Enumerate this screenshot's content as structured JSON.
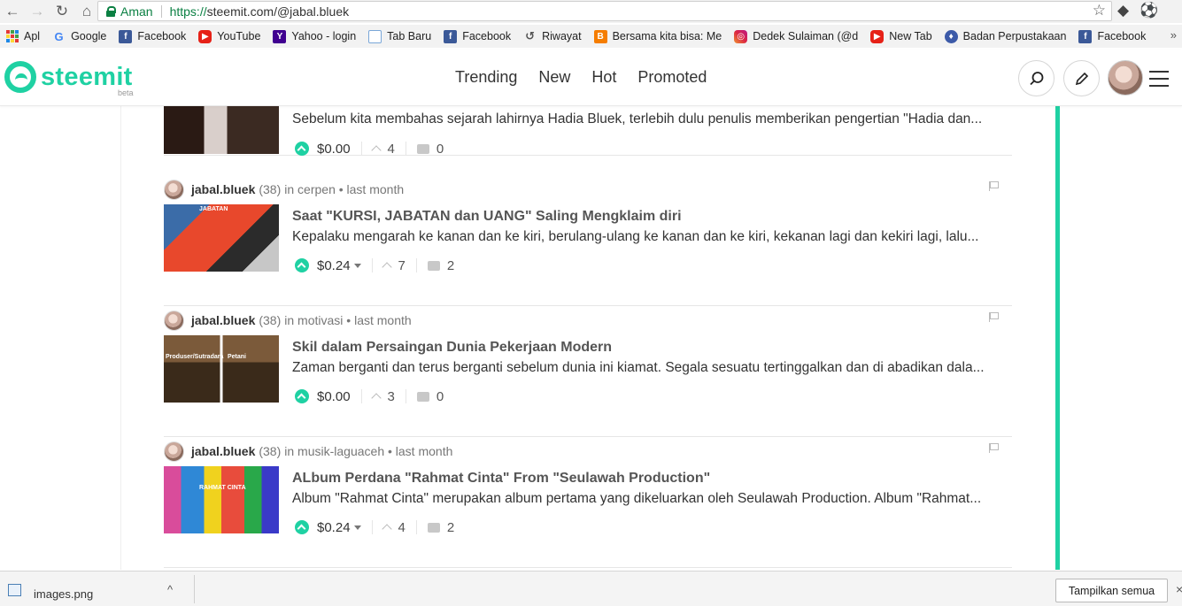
{
  "browser": {
    "back_icon": "←",
    "forward_icon": "→",
    "reload_icon": "↻",
    "home_icon": "⌂",
    "secure_label": "Aman",
    "url_scheme": "https://",
    "url_rest": "steemit.com/@jabal.bluek",
    "star_icon": "☆"
  },
  "bookmarks": [
    {
      "label": "Apl",
      "icon": "apps-icon"
    },
    {
      "label": "Google",
      "icon": "google-icon",
      "glyph": "G"
    },
    {
      "label": "Facebook",
      "icon": "facebook-icon",
      "glyph": "f"
    },
    {
      "label": "YouTube",
      "icon": "youtube-icon",
      "glyph": "▶"
    },
    {
      "label": "Yahoo - login",
      "icon": "yahoo-icon",
      "glyph": "Y"
    },
    {
      "label": "Tab Baru",
      "icon": "page-icon",
      "glyph": ""
    },
    {
      "label": "Facebook",
      "icon": "facebook-icon",
      "glyph": "f"
    },
    {
      "label": "Riwayat",
      "icon": "history-icon",
      "glyph": "↺"
    },
    {
      "label": "Bersama kita bisa: Me",
      "icon": "blogger-icon",
      "glyph": "B"
    },
    {
      "label": "Dedek Sulaiman (@d",
      "icon": "instagram-icon",
      "glyph": "◎"
    },
    {
      "label": "New Tab",
      "icon": "youtube-icon",
      "glyph": "▶"
    },
    {
      "label": "Badan Perpustakaan",
      "icon": "library-icon",
      "glyph": "♦"
    },
    {
      "label": "Facebook",
      "icon": "facebook-icon",
      "glyph": "f"
    }
  ],
  "site": {
    "logo_text": "steemit",
    "logo_beta": "beta",
    "nav": [
      "Trending",
      "New",
      "Hot",
      "Promoted"
    ]
  },
  "posts": [
    {
      "author": "",
      "reputation": "",
      "category": "",
      "time": "",
      "title": "",
      "body": "Sebelum kita membahas sejarah lahirnya Hadia Bluek, terlebih dulu penulis memberikan pengertian \"Hadia dan...",
      "payout": "$0.00",
      "payout_caret": false,
      "votes": "4",
      "replies": "0",
      "thumb_labels": []
    },
    {
      "author": "jabal.bluek",
      "reputation": "(38)",
      "category": "in cerpen • last month",
      "time": "",
      "title": "Saat \"KURSI, JABATAN dan UANG\" Saling Mengklaim diri",
      "body": "Kepalaku mengarah ke kanan dan ke kiri, berulang-ulang ke kanan dan ke kiri, kekanan lagi dan kekiri lagi, lalu...",
      "payout": "$0.24",
      "payout_caret": true,
      "votes": "7",
      "replies": "2",
      "thumb_labels": [
        "JABATAN"
      ]
    },
    {
      "author": "jabal.bluek",
      "reputation": "(38)",
      "category": "in motivasi • last month",
      "time": "",
      "title": "Skil dalam Persaingan Dunia Pekerjaan Modern",
      "body": "Zaman berganti dan terus berganti sebelum dunia ini kiamat. Segala sesuatu tertinggalkan dan di abadikan dala...",
      "payout": "$0.00",
      "payout_caret": false,
      "votes": "3",
      "replies": "0",
      "thumb_labels": [
        "Produser/Sutradara",
        "Petani"
      ]
    },
    {
      "author": "jabal.bluek",
      "reputation": "(38)",
      "category": "in musik-laguaceh • last month",
      "time": "",
      "title": "ALbum Perdana \"Rahmat Cinta\" From \"Seulawah Production\"",
      "body": "Album \"Rahmat Cinta\" merupakan album pertama yang dikeluarkan oleh Seulawah Production. Album \"Rahmat...",
      "payout": "$0.24",
      "payout_caret": true,
      "votes": "4",
      "replies": "2",
      "thumb_labels": [
        "RAHMAT CINTA"
      ]
    }
  ],
  "download_shelf": {
    "file_name": "images.png",
    "chevron": "^",
    "show_all_label": "Tampilkan semua",
    "close_glyph": "×"
  }
}
